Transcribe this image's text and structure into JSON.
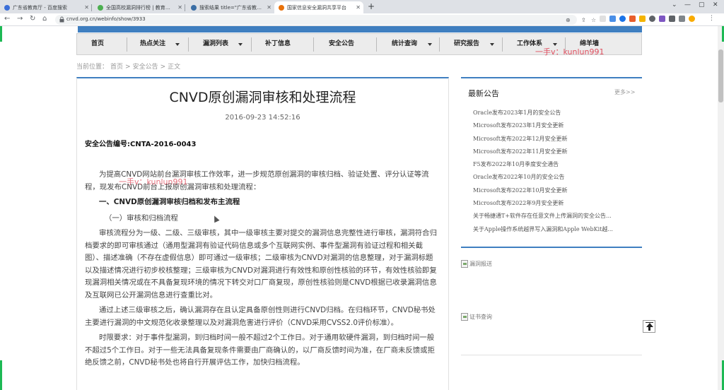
{
  "browser": {
    "tabs": [
      {
        "title": "广东省教育厅 - 百度搜索",
        "color": "#3b6fd8"
      },
      {
        "title": "全国高校漏洞排行榜 | 教育漏洞报告平台",
        "color": "#4caf50"
      },
      {
        "title": "搜索结果 title=\"广东省教育厅\" && ...",
        "color": "#3a6ea5"
      },
      {
        "title": "国家信息安全漏洞共享平台",
        "color": "#e8710a"
      }
    ],
    "active_tab": 3,
    "url": "cnvd.org.cn/webinfo/show/3933"
  },
  "nav": {
    "items": [
      {
        "label": "首页",
        "has_caret": false
      },
      {
        "label": "热点关注",
        "has_caret": true
      },
      {
        "label": "漏洞列表",
        "has_caret": true
      },
      {
        "label": "补丁信息",
        "has_caret": false
      },
      {
        "label": "安全公告",
        "has_caret": false
      },
      {
        "label": "统计查询",
        "has_caret": true
      },
      {
        "label": "研究报告",
        "has_caret": true
      },
      {
        "label": "工作体系",
        "has_caret": true
      },
      {
        "label": "绵羊墙",
        "has_caret": false
      }
    ]
  },
  "watermark": "一手v：kunlun991",
  "breadcrumb": {
    "prefix": "当前位置：",
    "items": [
      "首页",
      "安全公告",
      "正文"
    ],
    "separator": ">"
  },
  "article": {
    "title": "CNVD原创漏洞审核和处理流程",
    "date": "2016-09-23 14:52:16",
    "bulletin_no": "安全公告编号:CNTA-2016-0043",
    "intro": "为提高CNVD网站前台漏洞审核工作效率，进一步规范原创漏洞的审核归档、验证处置、评分认证等流程，现发布CNVD前台上报原创漏洞审核和处理流程：",
    "heading1": "一、CNVD原创漏洞审核归档和发布主流程",
    "heading2": "（一）审核和归档流程",
    "para1": "审核流程分为一级、二级、三级审核，其中一级审核主要对提交的漏洞信息完整性进行审核，漏洞符合归档要求的即可审核通过（通用型漏洞有验证代码信息或多个互联网实例、事件型漏洞有验证过程和相关截图）、描述准确（不存在虚假信息）即可通过一级审核；二级审核为CNVD对漏洞的信息整理，对于漏洞标题以及描述情况进行初步校核整理；三级审核为CNVD对漏洞进行有效性和原创性核验的环节，有效性核验即复现漏洞相关情况或在不具备复现环境的情况下转交对口厂商复现，原创性核验则是CNVD根据已收录漏洞信息及互联网已公开漏洞信息进行查重比对。",
    "para2": "通过上述三级审核之后，确认漏洞存在且认定具备原创性则进行CNVD归档。在归档环节，CNVD秘书处主要进行漏洞的中文规范化收录整理以及对漏洞危害进行评价（CNVD采用CVSS2.0评价标准）。",
    "para3": "时限要求：对于事件型漏洞，到归档时间一般不超过2个工作日。对于通用软硬件漏洞，到归档时间一般不超过5个工作日。对于一些无法具备复现条件需要由厂商确认的，以厂商反馈时间为准，在厂商未反馈或拒绝反馈之前，CNVD秘书处也将自行开展评估工作，加快归档流程。"
  },
  "sidebar": {
    "title": "最新公告",
    "more": "更多>>",
    "announcements": [
      "Oracle发布2023年1月的安全公告",
      "Microsoft发布2023年1月安全更新",
      "Microsoft发布2022年12月安全更新",
      "Microsoft发布2022年11月安全更新",
      "F5发布2022年10月季度安全通告",
      "Oracle发布2022年10月的安全公告",
      "Microsoft发布2022年10月安全更新",
      "Microsoft发布2022年9月安全更新",
      "关于畅捷通T+软件存在任意文件上传漏洞的安全公告...",
      "关于Apple操作系统越界写入漏洞和Apple WebKit越..."
    ],
    "image_links": [
      "漏洞报送",
      "证书查询"
    ]
  }
}
